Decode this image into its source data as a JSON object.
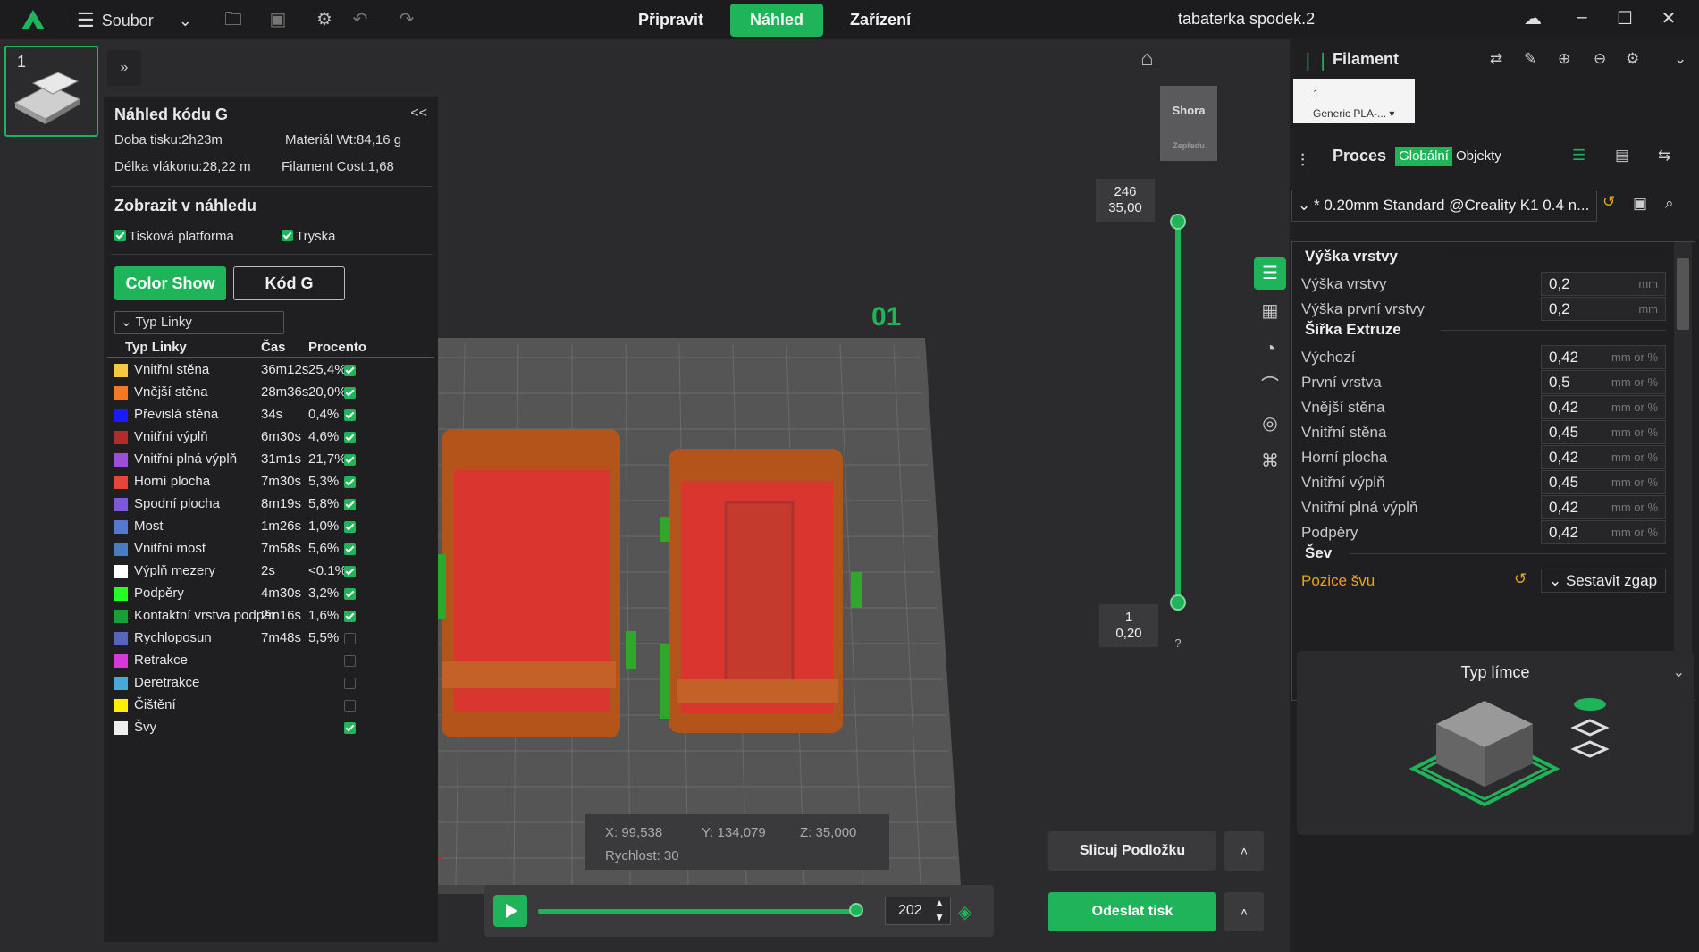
{
  "app": {
    "title": "tabaterka spodek.2",
    "menu_label": "Soubor"
  },
  "tabs": [
    {
      "label": "Připravit"
    },
    {
      "label": "Náhled"
    },
    {
      "label": "Zařízení"
    }
  ],
  "plate": {
    "number": "1",
    "label": "01"
  },
  "gcode": {
    "title": "Náhled kódu G",
    "collapse": "<<",
    "print_time": "Doba tisku:2h23m",
    "material": "Materiál Wt:84,16 g",
    "filament_length": "Délka vlákonu:28,22 m",
    "filament_cost": "Filament Cost:1,68",
    "show_title": "Zobrazit v náhledu",
    "opt_platform": "Tisková platforma",
    "opt_nozzle": "Tryska",
    "btn_color_show": "Color Show",
    "btn_gcode": "Kód G",
    "view_type": "Typ Linky",
    "col_type": "Typ Linky",
    "col_time": "Čas",
    "col_percent": "Procento",
    "rows": [
      {
        "name": "Vnitřní stěna",
        "time": "36m12s",
        "pct": "25,4%",
        "color": "#f5c842",
        "on": true
      },
      {
        "name": "Vnější stěna",
        "time": "28m36s",
        "pct": "20,0%",
        "color": "#f07a28",
        "on": true
      },
      {
        "name": "Převislá stěna",
        "time": "34s",
        "pct": "0,4%",
        "color": "#1a1aff",
        "on": true
      },
      {
        "name": "Vnitřní výplň",
        "time": "6m30s",
        "pct": "4,6%",
        "color": "#b02d2d",
        "on": true
      },
      {
        "name": "Vnitřní plná výplň",
        "time": "31m1s",
        "pct": "21,7%",
        "color": "#9b4fd6",
        "on": true
      },
      {
        "name": "Horní plocha",
        "time": "7m30s",
        "pct": "5,3%",
        "color": "#e8443c",
        "on": true
      },
      {
        "name": "Spodní plocha",
        "time": "8m19s",
        "pct": "5,8%",
        "color": "#7a5ad6",
        "on": true
      },
      {
        "name": "Most",
        "time": "1m26s",
        "pct": "1,0%",
        "color": "#5577cc",
        "on": true
      },
      {
        "name": "Vnitřní most",
        "time": "7m58s",
        "pct": "5,6%",
        "color": "#4a7cc0",
        "on": true
      },
      {
        "name": "Výplň mezery",
        "time": "2s",
        "pct": "<0.1%",
        "color": "#ffffff",
        "on": true
      },
      {
        "name": "Podpěry",
        "time": "4m30s",
        "pct": "3,2%",
        "color": "#22ff22",
        "on": true
      },
      {
        "name": "Kontaktní vrstva podpěr",
        "time": "2m16s",
        "pct": "1,6%",
        "color": "#1a9e3a",
        "on": true
      },
      {
        "name": "Rychloposun",
        "time": "7m48s",
        "pct": "5,5%",
        "color": "#5566bb",
        "on": false
      },
      {
        "name": "Retrakce",
        "time": "",
        "pct": "",
        "color": "#d63ad6",
        "on": false
      },
      {
        "name": "Deretrakce",
        "time": "",
        "pct": "",
        "color": "#4aa8d6",
        "on": false
      },
      {
        "name": "Čištění",
        "time": "",
        "pct": "",
        "color": "#ffee00",
        "on": false
      },
      {
        "name": "Švy",
        "time": "",
        "pct": "",
        "color": "#eeeeee",
        "on": true
      }
    ]
  },
  "viewport": {
    "cube_top": "Shora",
    "cube_front": "Zepředu",
    "layer_top_a": "246",
    "layer_top_b": "35,00",
    "layer_bot_a": "1",
    "layer_bot_b": "0,20",
    "layer_top_fraction": 1.0,
    "layer_bottom_fraction": 0.0,
    "help": "?",
    "coord_x": "X: 99,538",
    "coord_y": "Y: 134,079",
    "coord_z": "Z: 35,000",
    "speed": "Rychlost: 30",
    "move_value": "202",
    "move_fraction": 1.0,
    "btn_slice": "Slicuj Podložku",
    "btn_send": "Odeslat tisk",
    "caret": "˄"
  },
  "right": {
    "filament_title": "Filament",
    "filament_slot": "1",
    "filament_name": "Generic PLA-...",
    "process_title": "Proces",
    "tab_global": "Globální",
    "tab_objects": "Objekty",
    "preset": "* 0.20mm Standard @Creality K1 0.4 n...",
    "sections": [
      {
        "title": "Výška vrstvy"
      },
      {
        "title": "Šířka Extruze"
      },
      {
        "title": "Šev"
      }
    ],
    "params": [
      {
        "label": "Výška vrstvy",
        "value": "0,2",
        "unit": "mm"
      },
      {
        "label": "Výška první vrstvy",
        "value": "0,2",
        "unit": "mm"
      },
      {
        "label": "Výchozí",
        "value": "0,42",
        "unit": "mm or %"
      },
      {
        "label": "První vrstva",
        "value": "0,5",
        "unit": "mm or %"
      },
      {
        "label": "Vnější stěna",
        "value": "0,42",
        "unit": "mm or %"
      },
      {
        "label": "Vnitřní stěna",
        "value": "0,45",
        "unit": "mm or %"
      },
      {
        "label": "Horní plocha",
        "value": "0,42",
        "unit": "mm or %"
      },
      {
        "label": "Vnitřní výplň",
        "value": "0,45",
        "unit": "mm or %"
      },
      {
        "label": "Vnitřní plná výplň",
        "value": "0,42",
        "unit": "mm or %"
      },
      {
        "label": "Podpěry",
        "value": "0,42",
        "unit": "mm or %"
      }
    ],
    "seam_label": "Pozice švu",
    "seam_value": "Sestavit zgap",
    "brim_title": "Typ límce"
  },
  "colors": {
    "accent": "#1fb45a",
    "orange": "#e8a320"
  }
}
